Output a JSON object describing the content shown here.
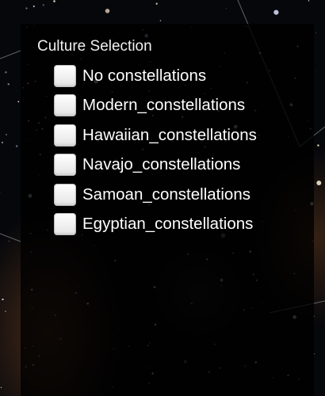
{
  "panel": {
    "title": "Culture Selection"
  },
  "cultures": [
    {
      "label": "No constellations",
      "checked": false
    },
    {
      "label": "Modern_constellations",
      "checked": false
    },
    {
      "label": "Hawaiian_constellations",
      "checked": false
    },
    {
      "label": "Navajo_constellations",
      "checked": false
    },
    {
      "label": "Samoan_constellations",
      "checked": false
    },
    {
      "label": "Egyptian_constellations",
      "checked": false
    }
  ],
  "colors": {
    "panel_background": "#000000",
    "text": "#ffffff",
    "checkbox_fill": "#f5f5f5"
  }
}
